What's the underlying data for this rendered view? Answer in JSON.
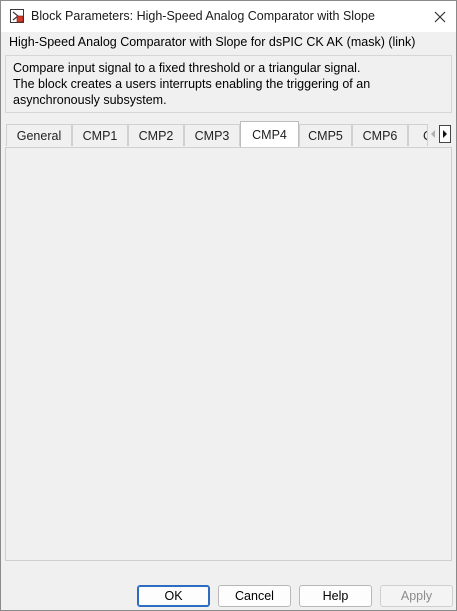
{
  "window": {
    "title": "Block Parameters: High-Speed Analog Comparator with Slope"
  },
  "mask": {
    "header": "High-Speed Analog Comparator with Slope for dsPIC CK  AK (mask) (link)",
    "description": [
      "Compare input signal to a fixed threshold or a triangular signal.",
      "The block creates a users interrupts enabling the triggering of an",
      "asynchronously subsystem."
    ]
  },
  "tabs": [
    {
      "label": "General",
      "active": false
    },
    {
      "label": "CMP1",
      "active": false
    },
    {
      "label": "CMP2",
      "active": false
    },
    {
      "label": "CMP3",
      "active": false
    },
    {
      "label": "CMP4",
      "active": true
    },
    {
      "label": "CMP5",
      "active": false
    },
    {
      "label": "CMP6",
      "active": false
    },
    {
      "label": "C",
      "active": false
    }
  ],
  "buttons": {
    "ok": "OK",
    "cancel": "Cancel",
    "help": "Help",
    "apply": "Apply"
  },
  "colors": {
    "background": "#f0f0f0",
    "default_button_border": "#2d6cc0"
  },
  "icons": {
    "app": "simulink-block-icon",
    "close": "close-icon",
    "tab_left": "tab-scroll-left-icon",
    "tab_right": "tab-scroll-right-icon"
  }
}
